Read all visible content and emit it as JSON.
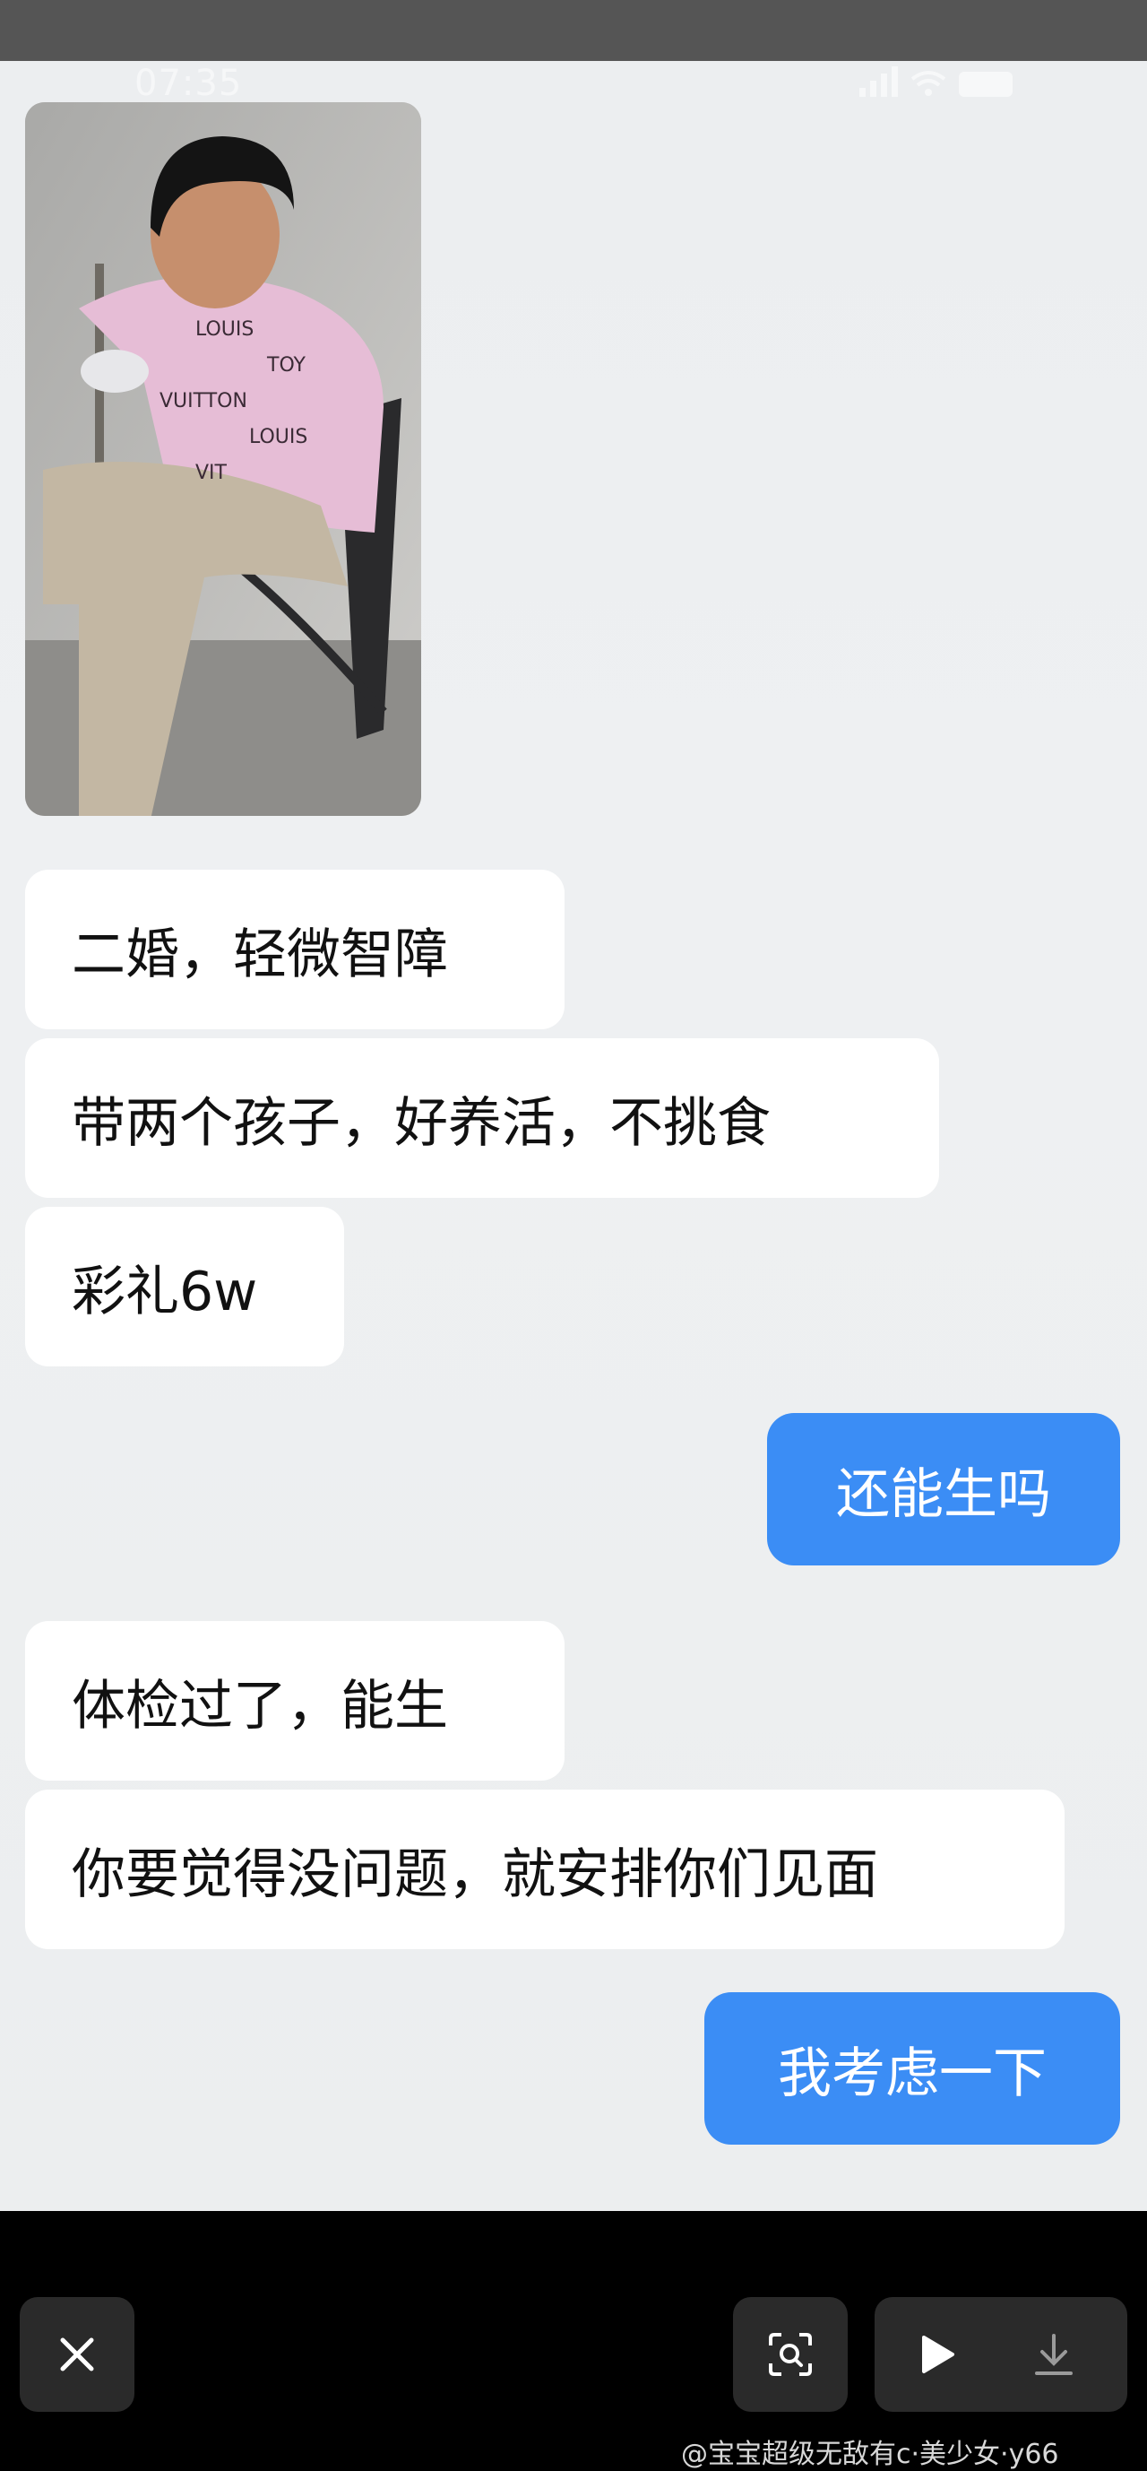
{
  "status_bar": {
    "time": "07:35"
  },
  "messages": [
    {
      "side": "received",
      "text": "二婚，轻微智障"
    },
    {
      "side": "received",
      "text": "带两个孩子，好养活，不挑食"
    },
    {
      "side": "received",
      "text": "彩礼6w"
    },
    {
      "side": "sent",
      "text": "还能生吗"
    },
    {
      "side": "received",
      "text": "体检过了，能生"
    },
    {
      "side": "received",
      "text": "你要觉得没问题，就安排你们见面"
    },
    {
      "side": "sent",
      "text": "我考虑一下"
    }
  ],
  "viewer_controls": {
    "close_icon": "close-icon",
    "scan_icon": "scan-icon",
    "play_icon": "play-icon",
    "download_icon": "download-icon"
  },
  "watermark": "@宝宝超级无敌有c·美少女·y66",
  "colors": {
    "sent_bubble": "#3b8df5",
    "received_bubble": "#ffffff",
    "chat_bg": "#eceef0"
  }
}
